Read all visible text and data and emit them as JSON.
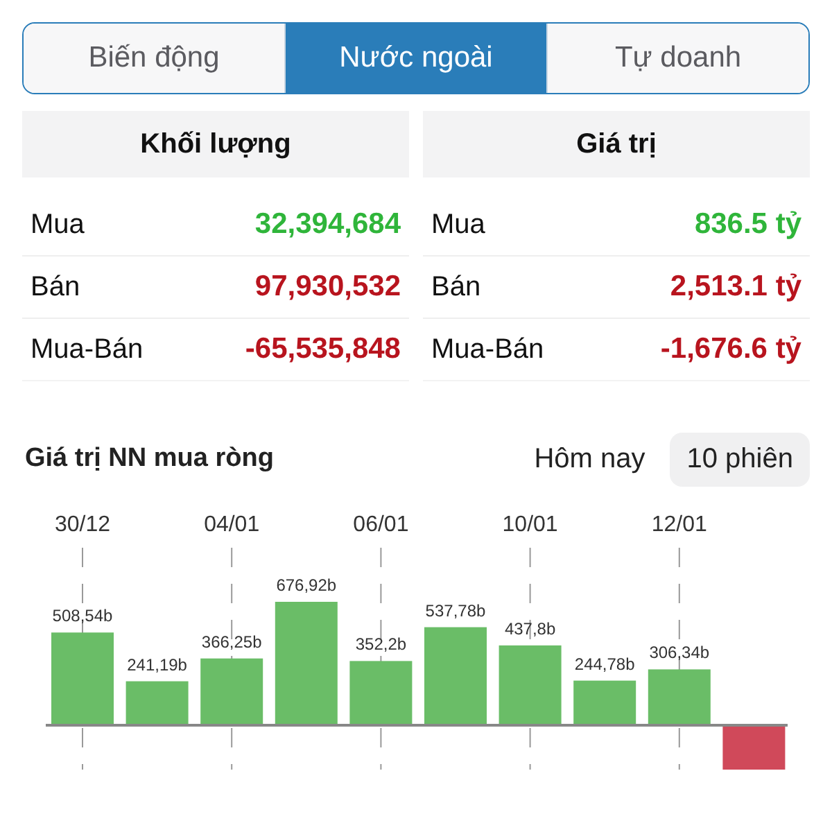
{
  "tabs": [
    {
      "label": "Biến động",
      "selected": false
    },
    {
      "label": "Nước ngoài",
      "selected": true
    },
    {
      "label": "Tự doanh",
      "selected": false
    }
  ],
  "tables": [
    {
      "header": "Khối lượng",
      "rows": [
        {
          "label": "Mua",
          "value": "32,394,684",
          "color": "#2fb53a"
        },
        {
          "label": "Bán",
          "value": "97,930,532",
          "color": "#b8141e"
        },
        {
          "label": "Mua-Bán",
          "value": "-65,535,848",
          "color": "#b8141e"
        }
      ]
    },
    {
      "header": "Giá trị",
      "rows": [
        {
          "label": "Mua",
          "value": "836.5 tỷ",
          "color": "#2fb53a"
        },
        {
          "label": "Bán",
          "value": "2,513.1 tỷ",
          "color": "#b8141e"
        },
        {
          "label": "Mua-Bán",
          "value": "-1,676.6 tỷ",
          "color": "#b8141e"
        }
      ]
    }
  ],
  "chart_section": {
    "title": "Giá trị NN mua ròng",
    "cut_off_last_bar": {
      "kind": "negative"
    },
    "periods": [
      {
        "label": "Hôm nay",
        "selected": false
      },
      {
        "label": "10 phiên",
        "selected": true
      }
    ],
    "chart_data": {
      "type": "bar",
      "categories": [
        "30/12",
        null,
        "04/01",
        null,
        "06/01",
        null,
        "10/01",
        null,
        "12/01",
        null
      ],
      "values": [
        508.54,
        241.19,
        366.25,
        676.92,
        352.2,
        537.78,
        437.8,
        244.78,
        306.34,
        null
      ],
      "value_labels": [
        "508,54b",
        "241,19b",
        "366,25b",
        "676,92b",
        "352,2b",
        "537,78b",
        "437,8b",
        "244,78b",
        "306,34b",
        null
      ],
      "grid": true
    }
  }
}
